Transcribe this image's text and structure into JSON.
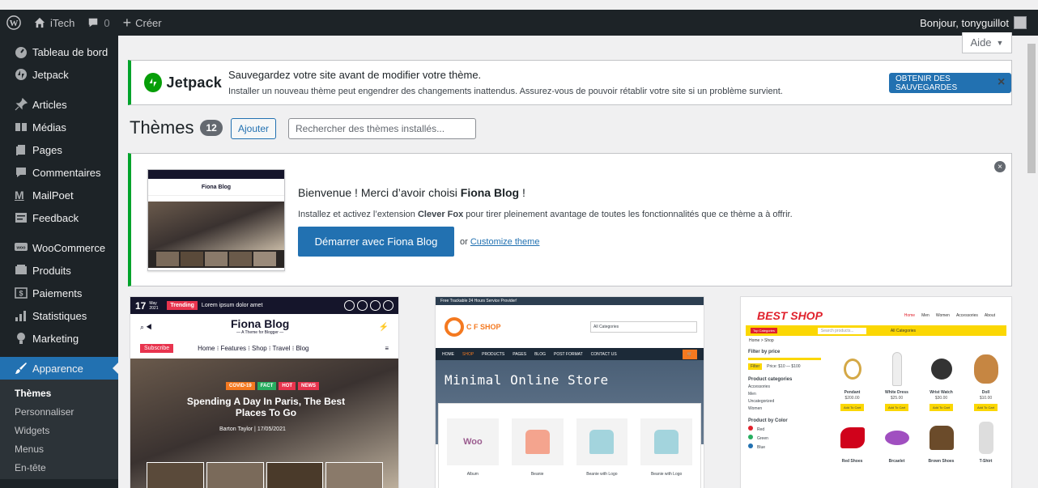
{
  "adminbar": {
    "site_name": "iTech",
    "comments_count": "0",
    "new_label": "Créer",
    "greeting": "Bonjour, tonyguillot"
  },
  "sidebar": {
    "items": [
      {
        "label": "Tableau de bord",
        "icon": "dashboard-icon"
      },
      {
        "label": "Jetpack",
        "icon": "jetpack-icon"
      },
      {
        "label": "Articles",
        "icon": "pin-icon"
      },
      {
        "label": "Médias",
        "icon": "media-icon"
      },
      {
        "label": "Pages",
        "icon": "pages-icon"
      },
      {
        "label": "Commentaires",
        "icon": "comments-icon"
      },
      {
        "label": "MailPoet",
        "icon": "mailpoet-icon"
      },
      {
        "label": "Feedback",
        "icon": "feedback-icon"
      },
      {
        "label": "WooCommerce",
        "icon": "woo-icon"
      },
      {
        "label": "Produits",
        "icon": "products-icon"
      },
      {
        "label": "Paiements",
        "icon": "payments-icon"
      },
      {
        "label": "Statistiques",
        "icon": "stats-icon"
      },
      {
        "label": "Marketing",
        "icon": "marketing-icon"
      },
      {
        "label": "Apparence",
        "icon": "appearance-icon"
      }
    ],
    "submenu": [
      "Thèmes",
      "Personnaliser",
      "Widgets",
      "Menus",
      "En-tête"
    ]
  },
  "help": {
    "label": "Aide"
  },
  "notice": {
    "brand": "Jetpack",
    "title": "Sauvegardez votre site avant de modifier votre thème.",
    "description": "Installer un nouveau thème peut engendrer des changements inattendus. Assurez-vous de pouvoir rétablir votre site si un problème survient.",
    "button": "OBTENIR DES SAUVEGARDES",
    "accent": "#00a32a"
  },
  "heading": {
    "title": "Thèmes",
    "count": "12",
    "add_label": "Ajouter",
    "search_placeholder": "Rechercher des thèmes installés..."
  },
  "welcome": {
    "title_prefix": "Bienvenue ! Merci d’avoir choisi ",
    "theme_name": "Fiona Blog",
    "title_suffix": " !",
    "desc_prefix": "Installez et activez l’extension ",
    "plugin": "Clever Fox",
    "desc_suffix": " pour tirer pleinement avantage de toutes les fonctionnalités que ce thème a à offrir.",
    "button": "Démarrer avec Fiona Blog",
    "or": "or",
    "link": "Customize theme"
  },
  "themes": {
    "fiona": {
      "date_day": "17",
      "date_month": "May 2021",
      "trending": "Trending",
      "ticker": "Lorem ipsum dolor amet",
      "logo": "Fiona Blog",
      "tagline": "— A Theme for Blogger —",
      "subscribe": "Subscribe",
      "nav": "Home ⁝ Features ⁝ Shop ⁝ Travel ⁝ Blog",
      "tags": [
        "COVID-19",
        "FACT",
        "HOT",
        "NEWS"
      ],
      "headline": "Spending A Day In Paris, The Best Places To Go",
      "byline": "Barton Taylor  |  17/05/2021"
    },
    "cfshop": {
      "topbar": "Free Trackable 24 Hours Service Provider!",
      "logo": "C F SHOP",
      "search": "All Categories",
      "nav": [
        "HOME",
        "SHOP",
        "PRODUCTS",
        "PAGES",
        "BLOG",
        "POST FORMAT",
        "CONTACT US"
      ],
      "banner": "Minimal Online Store",
      "products": [
        "Album",
        "Beanie",
        "Beanie with Logo",
        "Beanie with Logo"
      ]
    },
    "bestshop": {
      "logo": "BEST SHOP",
      "menu": [
        "Home",
        "Men",
        "Women",
        "Accessories",
        "About"
      ],
      "top_categories": "Top Categories",
      "search_placeholder": "Search products...",
      "all_categories": "All Categories",
      "crumb": "Home  >  Shop",
      "filter_title": "Filter by price",
      "filter_button": "Filter",
      "filter_range": "Price: $10 — $100",
      "cat_title": "Product categories",
      "categories": [
        "Accessories",
        "Men",
        "Uncategorized",
        "Women"
      ],
      "color_title": "Product by Color",
      "colors": [
        "Red",
        "Green",
        "Blue"
      ],
      "products": [
        {
          "name": "Pendant",
          "price": "$200.00"
        },
        {
          "name": "White Dress",
          "price": "$25.00"
        },
        {
          "name": "Wrist Watch",
          "price": "$30.00"
        },
        {
          "name": "Doll",
          "price": "$10.00"
        },
        {
          "name": "Red Shoes",
          "price": ""
        },
        {
          "name": "Brcaelet",
          "price": ""
        },
        {
          "name": "Brown Shoes",
          "price": ""
        },
        {
          "name": "T-Shirt",
          "price": ""
        }
      ],
      "add_to_cart": "Add To Cart"
    }
  }
}
